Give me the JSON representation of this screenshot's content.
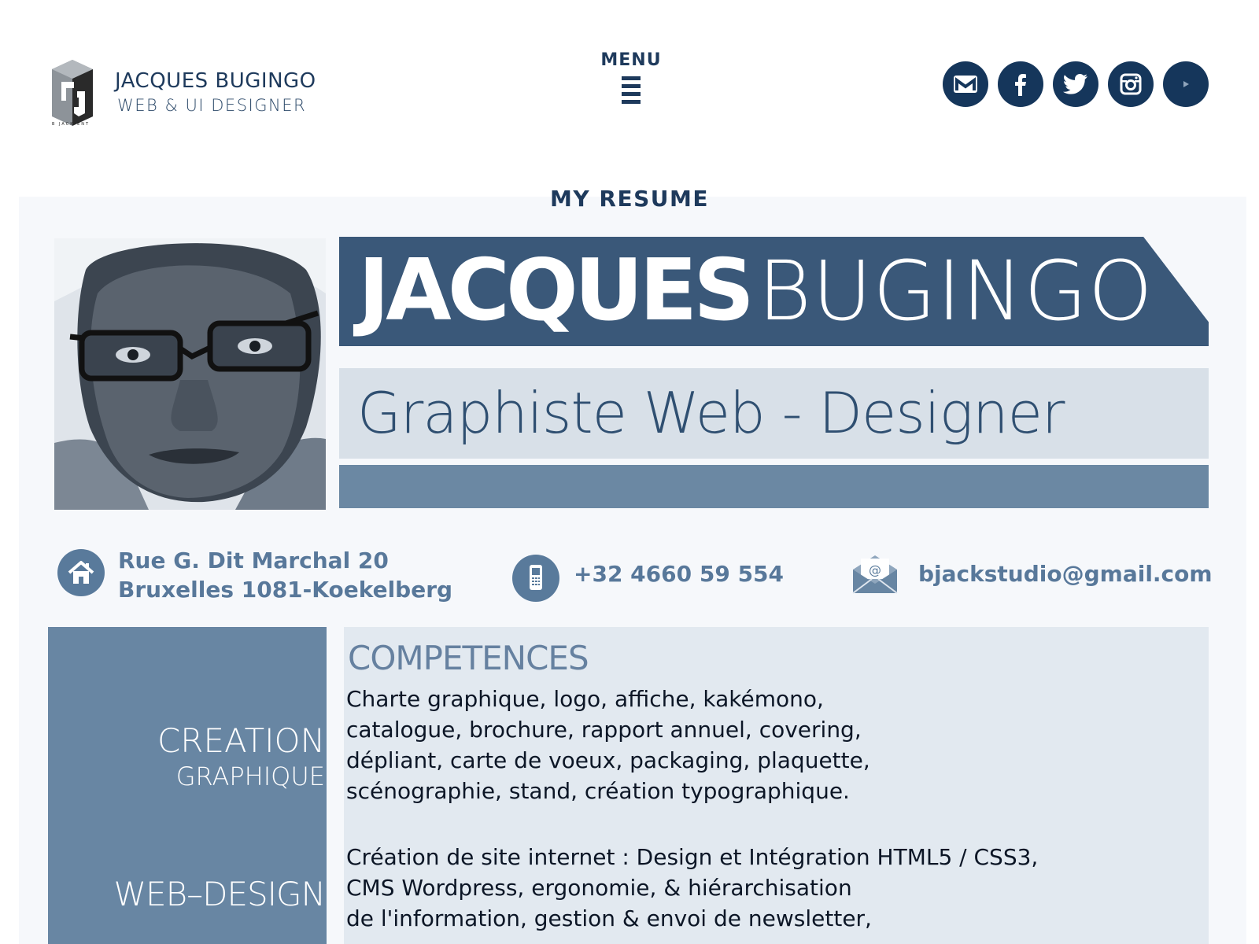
{
  "header": {
    "brand_name": "JACQUES BUGINGO",
    "brand_subtitle": "WEB & UI DESIGNER",
    "logo_tagline": "B JACK ENT",
    "menu_label": "MENU",
    "socials": [
      {
        "name": "gmail",
        "icon": "gmail-icon"
      },
      {
        "name": "facebook",
        "icon": "facebook-icon"
      },
      {
        "name": "twitter",
        "icon": "twitter-icon"
      },
      {
        "name": "instagram",
        "icon": "instagram-icon"
      },
      {
        "name": "youtube",
        "icon": "youtube-icon"
      }
    ]
  },
  "section_title": "MY RESUME",
  "resume": {
    "first_name": "JACQUES",
    "last_name": "BUGINGO",
    "job_title": "Graphiste  Web - Designer",
    "contact": {
      "address_line1": "Rue G. Dit Marchal 20",
      "address_line2": "Bruxelles 1081-Koekelberg",
      "phone": "+32 4660 59 554",
      "email": "bjackstudio@gmail.com"
    },
    "competences_title": "COMPETENCES",
    "categories": [
      {
        "line1": "CREATION",
        "line2": "GRAPHIQUE"
      },
      {
        "line1": "WEB–DESIGN"
      }
    ],
    "creation_lines": [
      "Charte graphique, logo, affiche, kakémono,",
      "catalogue, brochure, rapport annuel, covering,",
      "dépliant, carte de voeux, packaging, plaquette,",
      "scénographie, stand, création typographique."
    ],
    "web_lines": [
      "Création de site internet : Design et Intégration HTML5 / CSS3,",
      "CMS Wordpress, ergonomie, & hiérarchisation",
      "de l'information, gestion & envoi de newsletter,"
    ]
  },
  "colors": {
    "navy": "#1e3a5c",
    "banner": "#3a5879",
    "band_light": "#d8e0e8",
    "band_mid": "#6b88a3",
    "contact_text": "#58789a"
  }
}
